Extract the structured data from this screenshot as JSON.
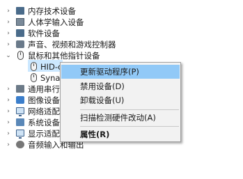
{
  "tree": {
    "items": [
      {
        "label": "内存技术设备",
        "expanded": false,
        "icon": "memory-device-icon"
      },
      {
        "label": "人体学输入设备",
        "expanded": false,
        "icon": "hid-device-icon"
      },
      {
        "label": "软件设备",
        "expanded": false,
        "icon": "software-device-icon"
      },
      {
        "label": "声音、视频和游戏控制器",
        "expanded": false,
        "icon": "speaker-icon"
      },
      {
        "label": "鼠标和其他指针设备",
        "expanded": true,
        "icon": "mouse-icon"
      },
      {
        "label": "HID-c",
        "child": true,
        "selected": true,
        "icon": "mouse-icon"
      },
      {
        "label": "Synap",
        "child": true,
        "icon": "mouse-icon"
      },
      {
        "label": "通用串行",
        "expanded": false,
        "icon": "usb-icon"
      },
      {
        "label": "图像设备",
        "expanded": false,
        "icon": "camera-icon"
      },
      {
        "label": "网络适配",
        "expanded": false,
        "icon": "network-adapter-icon"
      },
      {
        "label": "系统设备",
        "expanded": false,
        "icon": "system-device-icon"
      },
      {
        "label": "显示适配",
        "expanded": false,
        "icon": "display-adapter-icon"
      },
      {
        "label": "音频输入和输出",
        "expanded": false,
        "icon": "audio-io-icon"
      }
    ]
  },
  "context_menu": {
    "items": [
      {
        "label": "更新驱动程序(P)",
        "highlighted": true
      },
      {
        "label": "禁用设备(D)"
      },
      {
        "label": "卸载设备(U)"
      },
      {
        "label": "扫描检测硬件改动(A)"
      },
      {
        "label": "属性(R)",
        "bold": true
      }
    ]
  },
  "colors": {
    "selection": "#cce8ff",
    "menu_highlight": "#91c9f7",
    "menu_bg": "#f2f2f2"
  }
}
